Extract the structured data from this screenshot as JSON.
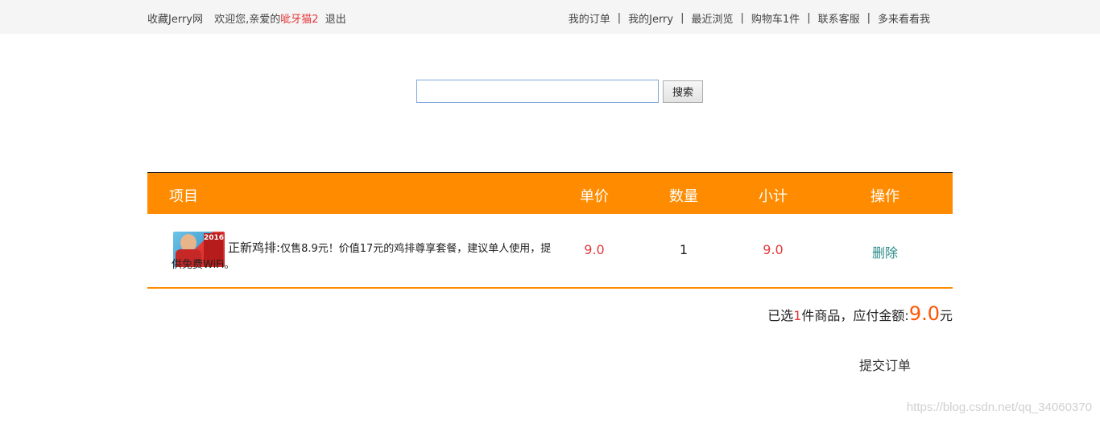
{
  "topbar": {
    "site_name": "收藏Jerry网",
    "welcome": "欢迎您,亲爱的",
    "username": "呲牙猫2",
    "logout": "退出",
    "links": [
      {
        "label": "我的订单"
      },
      {
        "label": "我的Jerry"
      },
      {
        "label": "最近浏览"
      },
      {
        "label": "购物车1件"
      },
      {
        "label": "联系客服"
      },
      {
        "label": "多来看看我"
      }
    ],
    "separator": "|"
  },
  "search": {
    "value": "",
    "button_label": "搜索"
  },
  "table": {
    "headers": {
      "item": "项目",
      "price": "单价",
      "qty": "数量",
      "subtotal": "小计",
      "op": "操作"
    },
    "rows": [
      {
        "name": "正新鸡排:",
        "desc": "仅售8.9元！价值17元的鸡排尊享套餐，建议单人使用，提供免费WiFi。",
        "thumb_badge": "2016",
        "price": "9.0",
        "qty": "1",
        "subtotal": "9.0",
        "action": "删除"
      }
    ]
  },
  "summary": {
    "prefix": "已选",
    "count": "1",
    "mid": "件商品，应付金额:",
    "amount": "9.0",
    "suffix": "元"
  },
  "submit_label": "提交订单",
  "watermark": "https://blog.csdn.net/qq_34060370",
  "colors": {
    "accent": "#ff8c00",
    "price_red": "#e4393c",
    "amount_orange": "#ff5500",
    "delete_teal": "#2a8a8a"
  }
}
